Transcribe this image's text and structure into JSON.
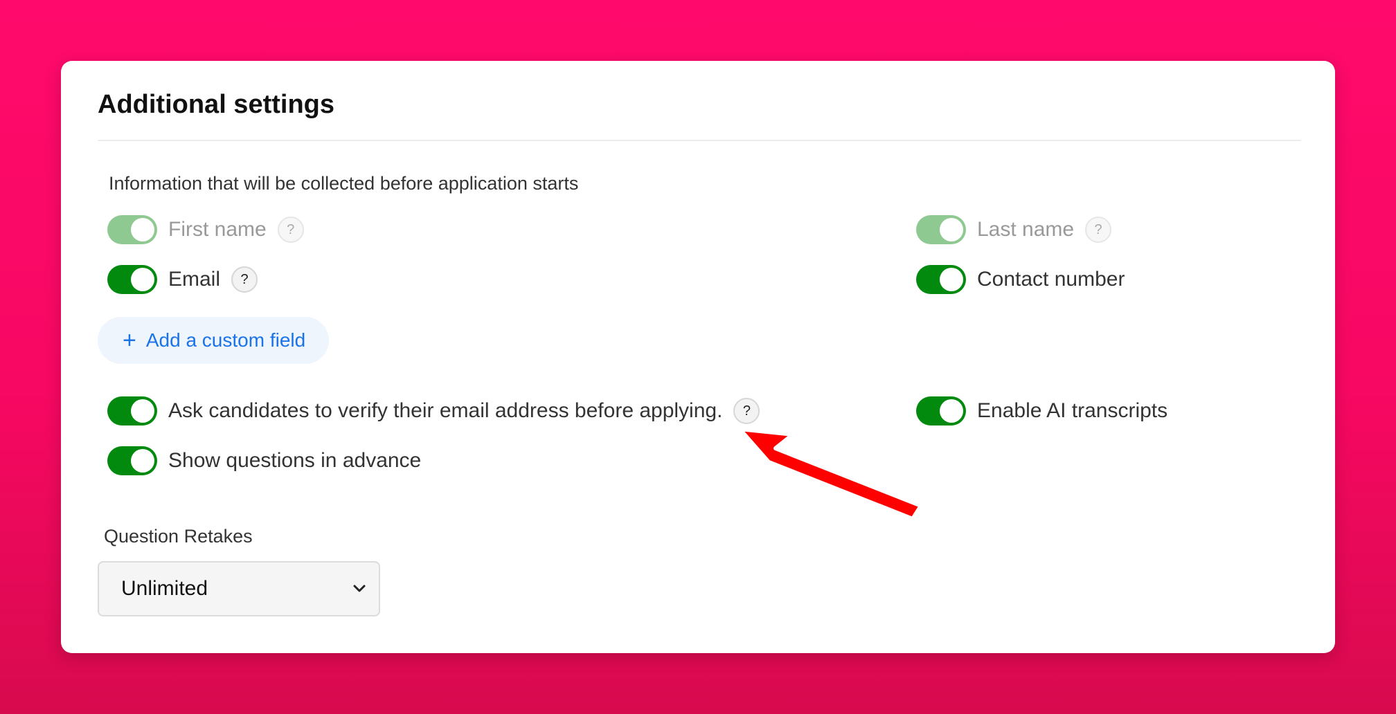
{
  "panel": {
    "title": "Additional settings",
    "subtitle": "Information that will be collected before application starts"
  },
  "fields": {
    "first_name": {
      "label": "First name",
      "enabled": true,
      "disabled": true
    },
    "last_name": {
      "label": "Last name",
      "enabled": true,
      "disabled": true
    },
    "email": {
      "label": "Email",
      "enabled": true
    },
    "contact_number": {
      "label": "Contact number",
      "enabled": true
    }
  },
  "add_custom_field": {
    "icon": "plus-icon",
    "label": "Add a custom field"
  },
  "options": {
    "verify_email": {
      "label": "Ask candidates to verify their email address before applying.",
      "enabled": true
    },
    "ai_transcripts": {
      "label": "Enable AI transcripts",
      "enabled": true
    },
    "show_questions": {
      "label": "Show questions in advance",
      "enabled": true
    }
  },
  "help_icon_text": "?",
  "question_retakes": {
    "label": "Question Retakes",
    "selected": "Unlimited",
    "chevron": "⌄"
  },
  "colors": {
    "background": "#ff0a6c",
    "toggle_on": "#028a0f",
    "toggle_disabled": "#8fc992",
    "link": "#1a73e8",
    "annotation_arrow": "#ff0000"
  }
}
